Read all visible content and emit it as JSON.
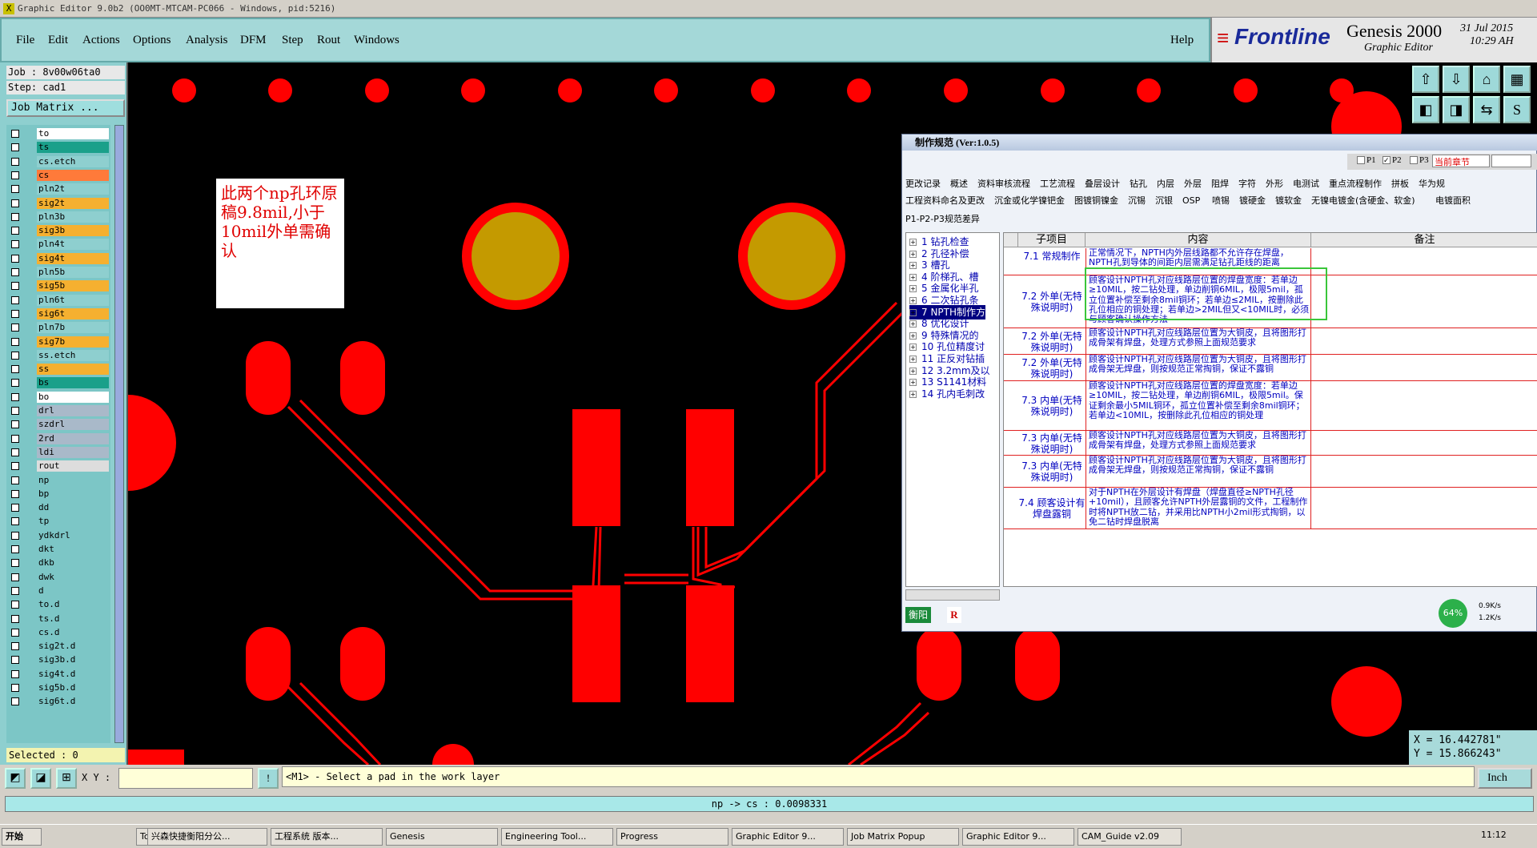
{
  "window": {
    "title": "Graphic Editor 9.0b2 (OO0MT-MTCAM-PC066 - Windows, pid:5216)"
  },
  "menu": {
    "items": [
      "File",
      "Edit",
      "Actions",
      "Options",
      "Analysis",
      "DFM",
      "Step",
      "Rout",
      "Windows"
    ],
    "help": "Help"
  },
  "logo": {
    "brand": "Frontline",
    "product": "Genesis 2000",
    "subtitle": "Graphic Editor",
    "date": "31 Jul 2015",
    "time": "10:29 AH"
  },
  "job": {
    "job": "Job : 8v00w06ta0",
    "step": "Step: cad1",
    "matrix_button": "Job Matrix ..."
  },
  "layers": [
    {
      "name": "to",
      "color": "#ffffff"
    },
    {
      "name": "ts",
      "color": "#1aa08a"
    },
    {
      "name": "cs.etch",
      "color": "#8ecfcf"
    },
    {
      "name": "cs",
      "color": "#ff7a3a"
    },
    {
      "name": "pln2t",
      "color": "#8ecfcf"
    },
    {
      "name": "sig2t",
      "color": "#f5b030"
    },
    {
      "name": "pln3b",
      "color": "#8ecfcf"
    },
    {
      "name": "sig3b",
      "color": "#f5b030"
    },
    {
      "name": "pln4t",
      "color": "#8ecfcf"
    },
    {
      "name": "sig4t",
      "color": "#f5b030"
    },
    {
      "name": "pln5b",
      "color": "#8ecfcf"
    },
    {
      "name": "sig5b",
      "color": "#f5b030"
    },
    {
      "name": "pln6t",
      "color": "#8ecfcf"
    },
    {
      "name": "sig6t",
      "color": "#f5b030"
    },
    {
      "name": "pln7b",
      "color": "#8ecfcf"
    },
    {
      "name": "sig7b",
      "color": "#f5b030"
    },
    {
      "name": "ss.etch",
      "color": "#8ecfcf"
    },
    {
      "name": "ss",
      "color": "#f5b030"
    },
    {
      "name": "bs",
      "color": "#1aa08a"
    },
    {
      "name": "bo",
      "color": "#ffffff"
    },
    {
      "name": "drl",
      "color": "#a9b9c9"
    },
    {
      "name": "szdrl",
      "color": "#a9b9c9"
    },
    {
      "name": "2rd",
      "color": "#a9b9c9"
    },
    {
      "name": "ldi",
      "color": "#a9b9c9"
    },
    {
      "name": "rout",
      "color": "#dddddd"
    },
    {
      "name": "np",
      "color": "#7cc6c6"
    },
    {
      "name": "bp",
      "color": "#7cc6c6"
    },
    {
      "name": "dd",
      "color": "#7cc6c6"
    },
    {
      "name": "tp",
      "color": "#7cc6c6"
    },
    {
      "name": "ydkdrl",
      "color": "#7cc6c6"
    },
    {
      "name": "dkt",
      "color": "#7cc6c6"
    },
    {
      "name": "dkb",
      "color": "#7cc6c6"
    },
    {
      "name": "dwk",
      "color": "#7cc6c6"
    },
    {
      "name": "d",
      "color": "#7cc6c6"
    },
    {
      "name": "to.d",
      "color": "#7cc6c6"
    },
    {
      "name": "ts.d",
      "color": "#7cc6c6"
    },
    {
      "name": "cs.d",
      "color": "#7cc6c6"
    },
    {
      "name": "sig2t.d",
      "color": "#7cc6c6"
    },
    {
      "name": "sig3b.d",
      "color": "#7cc6c6"
    },
    {
      "name": "sig4t.d",
      "color": "#7cc6c6"
    },
    {
      "name": "sig5b.d",
      "color": "#7cc6c6"
    },
    {
      "name": "sig6t.d",
      "color": "#7cc6c6"
    }
  ],
  "selected": "Selected : 0",
  "note": {
    "text": "此两个np孔环原稿9.8mil,小于10mil外单需确认"
  },
  "coords": {
    "x": "X = 16.442781\"",
    "y": "Y = 15.866243\""
  },
  "spec": {
    "title": "制作规范 (Ver:1.0.5)",
    "controls": {
      "p1": "P1",
      "p2": "P2",
      "p3": "P3",
      "chapter": "当前章节"
    },
    "tabs_row1": [
      "更改记录",
      "概述",
      "资料审核流程",
      "工艺流程",
      "叠层设计",
      "钻孔",
      "内层",
      "外层",
      "阻焊",
      "字符",
      "外形",
      "电测试",
      "重点流程制作",
      "拼板",
      "华为规"
    ],
    "tabs_row2": [
      "工程资料命名及更改",
      "沉金或化学镍钯金",
      "图镀铜镍金",
      "沉锡",
      "沉银",
      "OSP",
      "喷锡",
      "镀硬金",
      "镀软金",
      "无镍电镀金(含硬金、软金)",
      "电镀面积"
    ],
    "subtab": "P1-P2-P3规范差异",
    "tree": [
      "1 钻孔检查",
      "2 孔径补偿",
      "3 槽孔",
      "4 阶梯孔、槽",
      "5 金属化半孔",
      "6 二次钻孔条",
      "7 NPTH制作方",
      "8 优化设计",
      "9 特殊情况的",
      "10 孔位精度讨",
      "11 正反对钻插",
      "12 3.2mm及以",
      "13 S1141材料",
      "14 孔内毛刺改"
    ],
    "headers": {
      "sub": "子项目",
      "content": "内容",
      "remark": "备注"
    },
    "rows": [
      {
        "sub": "7.1 常规制作",
        "content": "正常情况下，NPTH内外层线路都不允许存在焊盘，NPTH孔到导体的间距内层需满足钻孔距线的距离"
      },
      {
        "sub": "7.2 外单(无特殊说明时)",
        "content": "顾客设计NPTH孔对应线路层位置的焊盘宽度：若单边≥10MIL，按二钻处理，单边削铜6MIL，极限5mil，孤立位置补偿至剩余8mil铜环；若单边≤2MIL，按删除此孔位相应的铜处理；若单边>2MIL但又<10MIL时，必须与顾客确认操作方法"
      },
      {
        "sub": "7.2 外单(无特殊说明时)",
        "content": "顾客设计NPTH孔对应线路层位置为大铜皮，且将图形打成骨架有焊盘，处理方式参照上面规范要求"
      },
      {
        "sub": "7.2 外单(无特殊说明时)",
        "content": "顾客设计NPTH孔对应线路层位置为大铜皮，且将图形打成骨架无焊盘，则按规范正常掏铜，保证不露铜"
      },
      {
        "sub": "7.3 内单(无特殊说明时)",
        "content": "顾客设计NPTH孔对应线路层位置的焊盘宽度：若单边≥10MIL，按二钻处理，单边削铜6MIL，极限5mil。保证剩余最小5MIL铜环，孤立位置补偿至剩余8mil铜环；若单边<10MIL，按删除此孔位相应的铜处理"
      },
      {
        "sub": "7.3 内单(无特殊说明时)",
        "content": "顾客设计NPTH孔对应线路层位置为大铜皮，且将图形打成骨架有焊盘，处理方式参照上面规范要求"
      },
      {
        "sub": "7.3 内单(无特殊说明时)",
        "content": "顾客设计NPTH孔对应线路层位置为大铜皮，且将图形打成骨架无焊盘，则按规范正常掏铜，保证不露铜"
      },
      {
        "sub": "7.4 顾客设计有焊盘露铜",
        "content": "对于NPTH在外层设计有焊盘（焊盘直径≥NPTH孔径+10mil），且顾客允许NPTH外层露铜的文件，工程制作时将NPTH放二钻，并采用比NPTH小2mil形式掏铜，以免二钻时焊盘脱离"
      }
    ],
    "footer": "衡阳",
    "footer_r": "R",
    "net_pct": "64%",
    "net_up": "0.9K/s",
    "net_down": "1.2K/s"
  },
  "cmd": {
    "xy_label": "X Y :",
    "prompt": "<M1> - Select a pad in the work layer",
    "units": "Inch"
  },
  "status": "np -> cs : 0.0098331",
  "taskbar": {
    "start": "开始",
    "tasks": [
      "Total Commander ...",
      "兴森快捷衡阳分公...",
      "工程系统  版本...",
      "Genesis",
      "Engineering Tool...",
      "Progress",
      "Graphic Editor 9...",
      "Job Matrix Popup",
      "Graphic Editor 9...",
      "CAM_Guide v2.09"
    ],
    "clock": "11:12"
  }
}
